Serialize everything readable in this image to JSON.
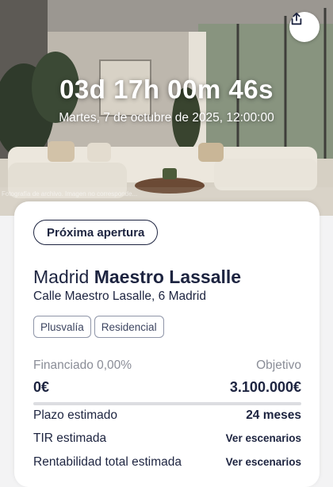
{
  "hero": {
    "countdown": "03d 17h 00m 46s",
    "open_date": "Martes, 7 de octubre de 2025, 12:00:00",
    "photo_credit": "Fotografía de archivo. Imagen no corresponde...",
    "share_icon": "share-icon"
  },
  "card": {
    "status_pill": "Próxima apertura",
    "title_city": "Madrid",
    "title_name": "Maestro Lassalle",
    "address": "Calle Maestro Lasalle, 6 Madrid",
    "tags": [
      "Plusvalía",
      "Residencial"
    ],
    "funding": {
      "financed_label": "Financiado 0,00%",
      "target_label": "Objetivo",
      "financed_value": "0€",
      "target_value": "3.100.000€",
      "progress_fraction": 0.0
    },
    "details": [
      {
        "label": "Plazo estimado",
        "value": "24 meses"
      },
      {
        "label": "TIR estimada",
        "value": "Ver escenarios"
      },
      {
        "label": "Rentabilidad total estimada",
        "value": "Ver escenarios"
      }
    ]
  },
  "colors": {
    "accent": "#1d2440",
    "muted": "#8a8d97",
    "card_bg": "#ffffff"
  }
}
